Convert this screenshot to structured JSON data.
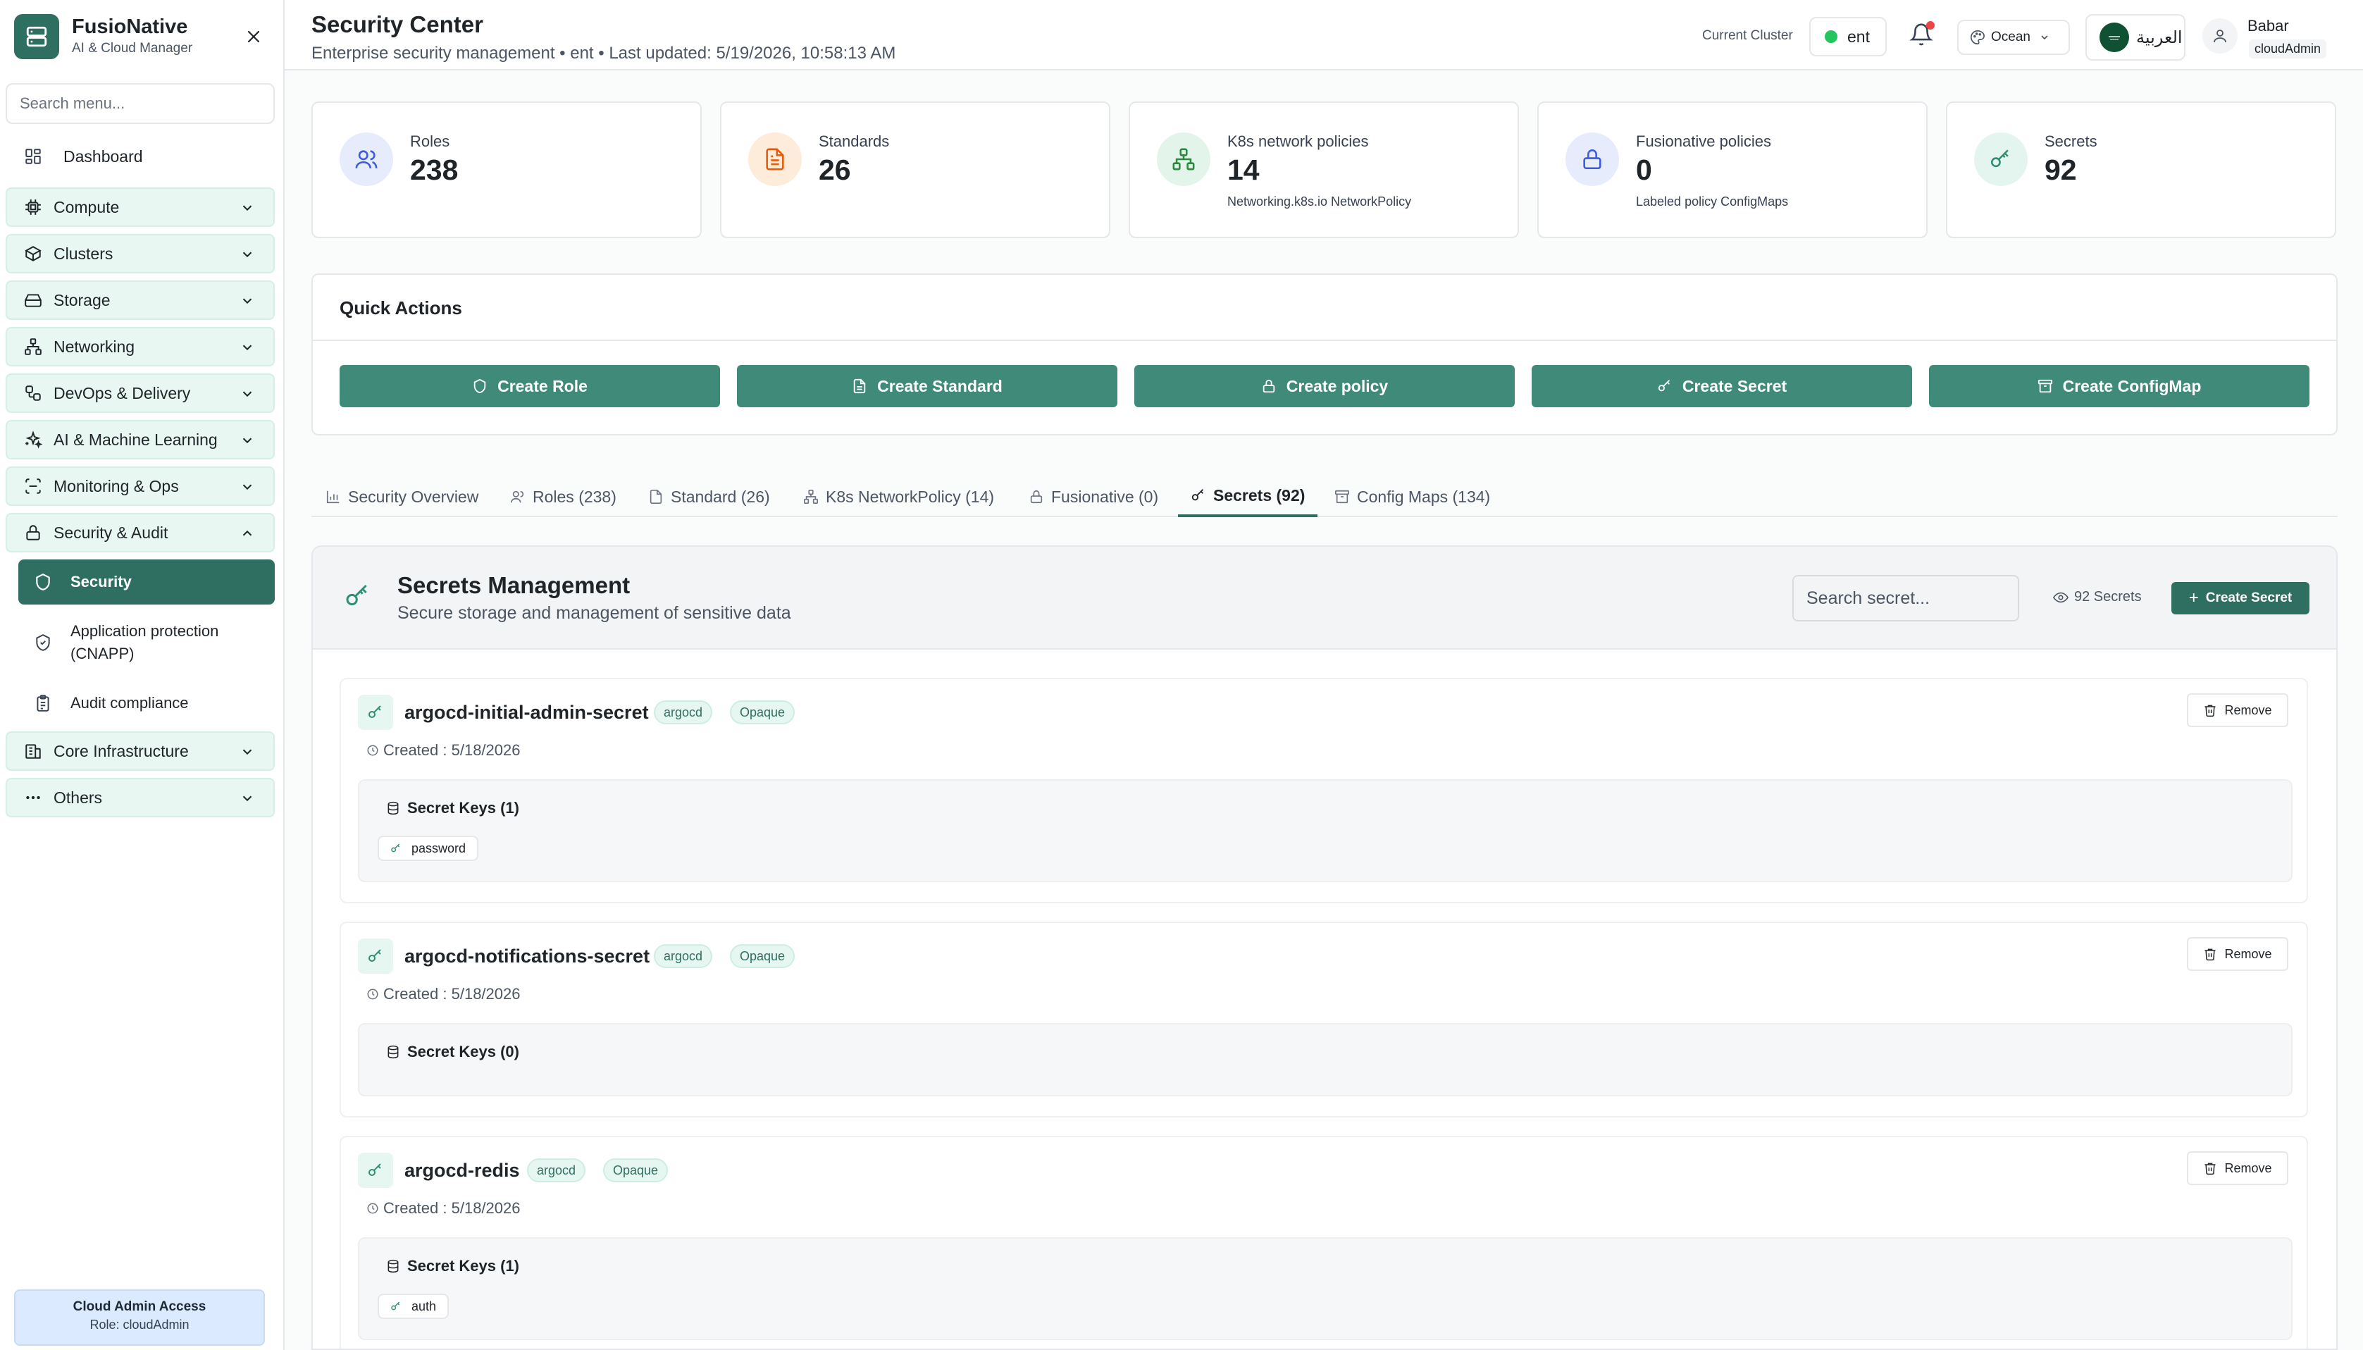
{
  "brand": {
    "name": "FusioNative",
    "subtitle": "AI & Cloud Manager"
  },
  "sidebar": {
    "search_placeholder": "Search menu...",
    "dashboard": "Dashboard",
    "groups": [
      {
        "label": "Compute"
      },
      {
        "label": "Clusters"
      },
      {
        "label": "Storage"
      },
      {
        "label": "Networking"
      },
      {
        "label": "DevOps & Delivery"
      },
      {
        "label": "AI & Machine Learning"
      },
      {
        "label": "Monitoring & Ops"
      },
      {
        "label": "Security & Audit"
      },
      {
        "label": "Core Infrastructure"
      },
      {
        "label": "Others"
      }
    ],
    "security_sub": [
      {
        "label": "Security"
      },
      {
        "label": "Application protection (CNAPP)"
      },
      {
        "label": "Audit compliance"
      }
    ],
    "footer": {
      "title": "Cloud Admin Access",
      "role": "Role: cloudAdmin"
    }
  },
  "header": {
    "title": "Security Center",
    "subtitle": "Enterprise security management • ent • Last updated: 5/19/2026, 10:58:13 AM",
    "cluster_label": "Current Cluster",
    "cluster": "ent",
    "theme": "Ocean",
    "language": "العربية",
    "user_name": "Babar",
    "user_role": "cloudAdmin"
  },
  "stats": [
    {
      "label": "Roles",
      "value": "238",
      "sub": ""
    },
    {
      "label": "Standards",
      "value": "26",
      "sub": ""
    },
    {
      "label": "K8s network policies",
      "value": "14",
      "sub": "Networking.k8s.io NetworkPolicy"
    },
    {
      "label": "Fusionative policies",
      "value": "0",
      "sub": "Labeled policy ConfigMaps"
    },
    {
      "label": "Secrets",
      "value": "92",
      "sub": ""
    }
  ],
  "quick_actions": {
    "title": "Quick Actions",
    "buttons": [
      "Create Role",
      "Create Standard",
      "Create policy",
      "Create Secret",
      "Create ConfigMap"
    ]
  },
  "tabs": [
    {
      "label": "Security Overview"
    },
    {
      "label": "Roles (238)"
    },
    {
      "label": "Standard (26)"
    },
    {
      "label": "K8s NetworkPolicy (14)"
    },
    {
      "label": "Fusionative (0)"
    },
    {
      "label": "Secrets (92)"
    },
    {
      "label": "Config Maps (134)"
    }
  ],
  "active_tab": "Secrets (92)",
  "secrets_panel": {
    "title": "Secrets Management",
    "subtitle": "Secure storage and management of sensitive data",
    "search_placeholder": "Search secret...",
    "count_label": "92 Secrets",
    "create_label": "Create Secret",
    "remove_label": "Remove",
    "items": [
      {
        "name": "argocd-initial-admin-secret",
        "namespace": "argocd",
        "type": "Opaque",
        "created": "Created : 5/18/2026",
        "keys_title": "Secret Keys (1)",
        "keys": [
          "password"
        ]
      },
      {
        "name": "argocd-notifications-secret",
        "namespace": "argocd",
        "type": "Opaque",
        "created": "Created : 5/18/2026",
        "keys_title": "Secret Keys (0)",
        "keys": []
      },
      {
        "name": "argocd-redis",
        "namespace": "argocd",
        "type": "Opaque",
        "created": "Created : 5/18/2026",
        "keys_title": "Secret Keys (1)",
        "keys": [
          "auth"
        ]
      }
    ]
  },
  "colors": {
    "primary": "#2f6f61",
    "action_button": "#3f8a78",
    "accent_light": "#e8f7f2",
    "footer_bg": "#dbeafe",
    "status_online": "#22c55e",
    "notification": "#ef4444"
  }
}
